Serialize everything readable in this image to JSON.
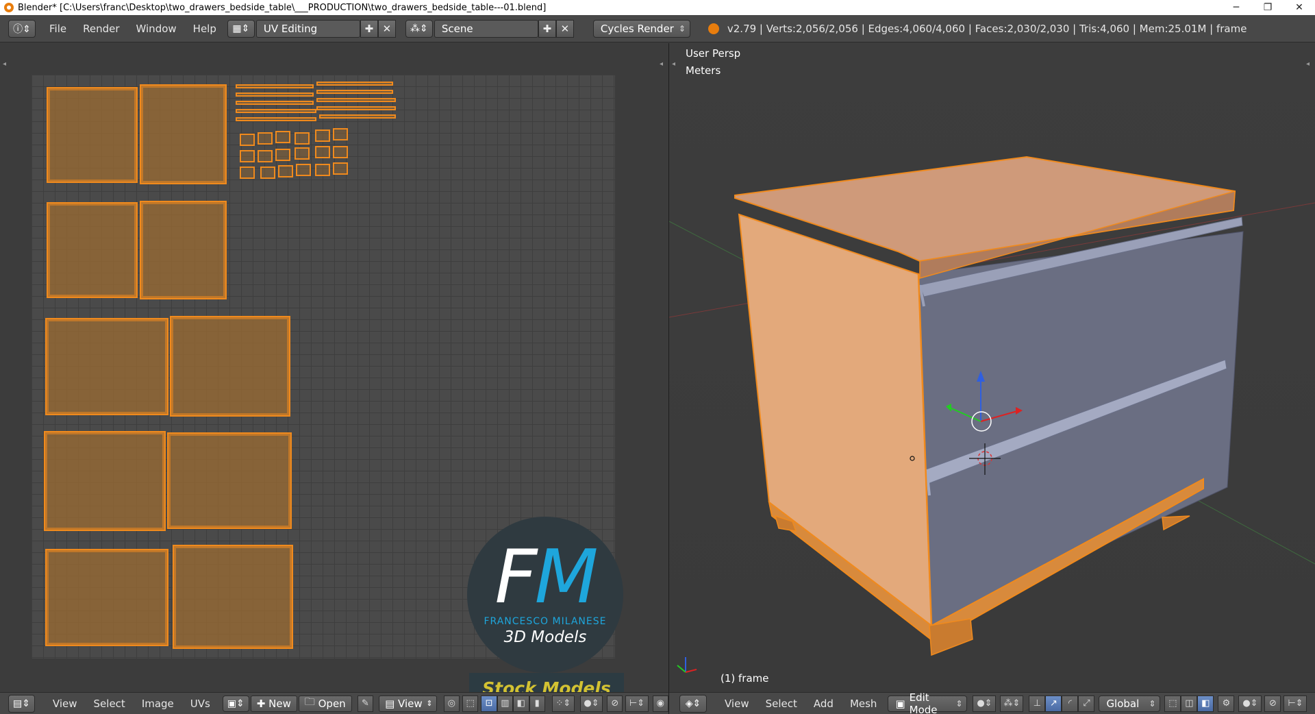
{
  "window": {
    "title": "Blender* [C:\\Users\\franc\\Desktop\\two_drawers_bedside_table\\___PRODUCTION\\two_drawers_bedside_table---01.blend]",
    "minimize": "─",
    "maximize": "❐",
    "close": "✕"
  },
  "info_header": {
    "menus": [
      "File",
      "Render",
      "Window",
      "Help"
    ],
    "screen_layout": "UV Editing",
    "scene": "Scene",
    "render_engine": "Cycles Render",
    "stats": "v2.79 | Verts:2,056/2,056 | Edges:4,060/4,060 | Faces:2,030/2,030 | Tris:4,060 | Mem:25.01M | frame"
  },
  "viewport": {
    "view_name": "User Persp",
    "units": "Meters",
    "object_label": "(1) frame"
  },
  "logo": {
    "letter_f": "F",
    "letter_m": "M",
    "brand": "FRANCESCO MILANESE",
    "tagline": "3D Models",
    "badge": "Stock Models"
  },
  "uv_footer": {
    "menus": [
      "View",
      "Select",
      "Image",
      "UVs"
    ],
    "new_label": "New",
    "open_label": "Open",
    "view_label": "View"
  },
  "vp_footer": {
    "menus": [
      "View",
      "Select",
      "Add",
      "Mesh"
    ],
    "mode": "Edit Mode",
    "orientation": "Global"
  },
  "colors": {
    "accent_orange": "#f08a1d",
    "header_bg": "#484848",
    "logo_blue": "#1ea6dc",
    "badge_yellow": "#d3c232"
  }
}
